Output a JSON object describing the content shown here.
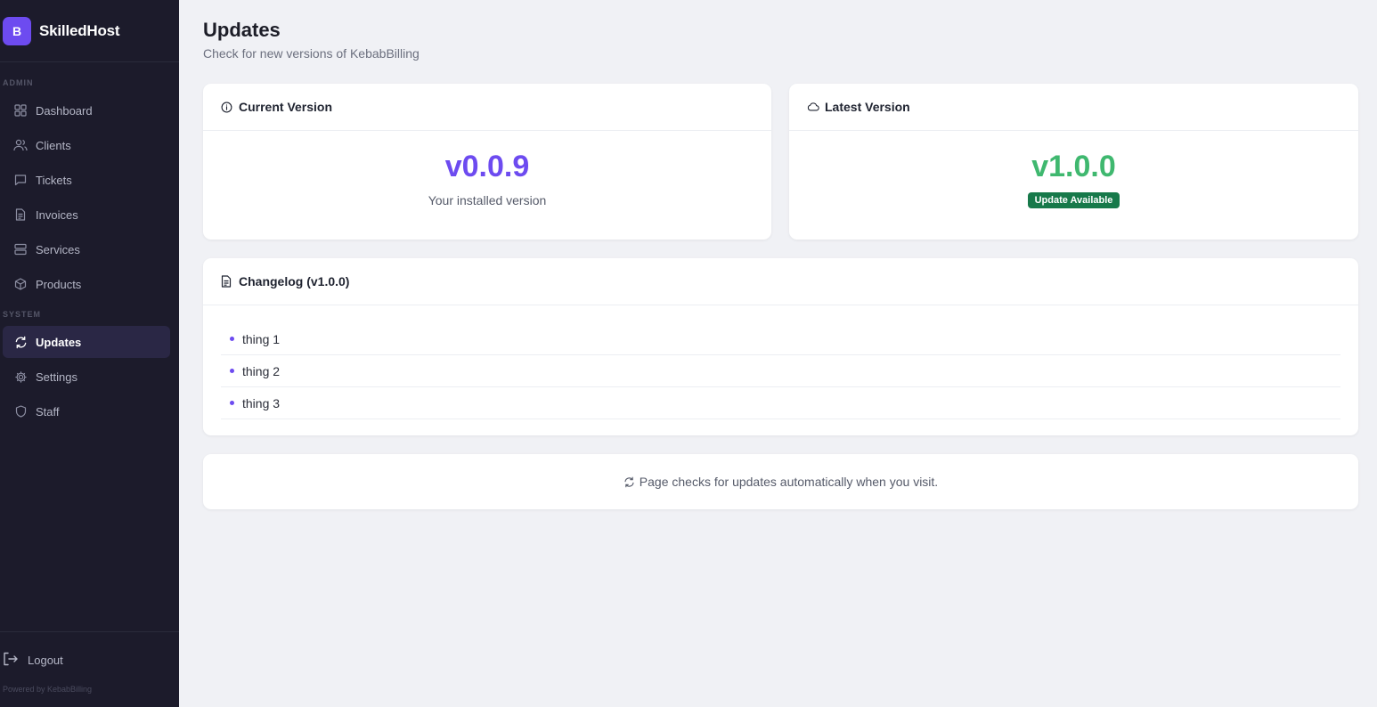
{
  "brand": {
    "logo_letter": "B",
    "name": "SkilledHost",
    "accent": "#6d4bf0"
  },
  "sidebar": {
    "sections": [
      {
        "label": "ADMIN"
      },
      {
        "label": "SYSTEM"
      }
    ],
    "items": [
      {
        "label": "Dashboard",
        "icon": "dashboard-grid-icon"
      },
      {
        "label": "Clients",
        "icon": "users-icon"
      },
      {
        "label": "Tickets",
        "icon": "message-square-icon"
      },
      {
        "label": "Invoices",
        "icon": "file-text-icon"
      },
      {
        "label": "Services",
        "icon": "server-icon"
      },
      {
        "label": "Products",
        "icon": "package-icon"
      },
      {
        "label": "Updates",
        "icon": "refresh-icon",
        "active": true
      },
      {
        "label": "Settings",
        "icon": "gear-icon"
      },
      {
        "label": "Staff",
        "icon": "shield-icon"
      }
    ],
    "logout_label": "Logout",
    "powered_by": "Powered by KebabBilling"
  },
  "page": {
    "title": "Updates",
    "subtitle": "Check for new versions of KebabBilling"
  },
  "current_version": {
    "heading": "Current Version",
    "icon": "info-icon",
    "version": "v0.0.9",
    "caption": "Your installed version",
    "color": "#6d4bf0"
  },
  "latest_version": {
    "heading": "Latest Version",
    "icon": "cloud-icon",
    "version": "v1.0.0",
    "badge": "Update Available",
    "color": "#3fb86f",
    "badge_color": "#17794a"
  },
  "changelog": {
    "heading": "Changelog (v1.0.0)",
    "icon": "document-icon",
    "items": [
      "thing 1",
      "thing 2",
      "thing 3"
    ]
  },
  "footer_note": {
    "text": "Page checks for updates automatically when you visit.",
    "icon": "refresh-icon"
  }
}
